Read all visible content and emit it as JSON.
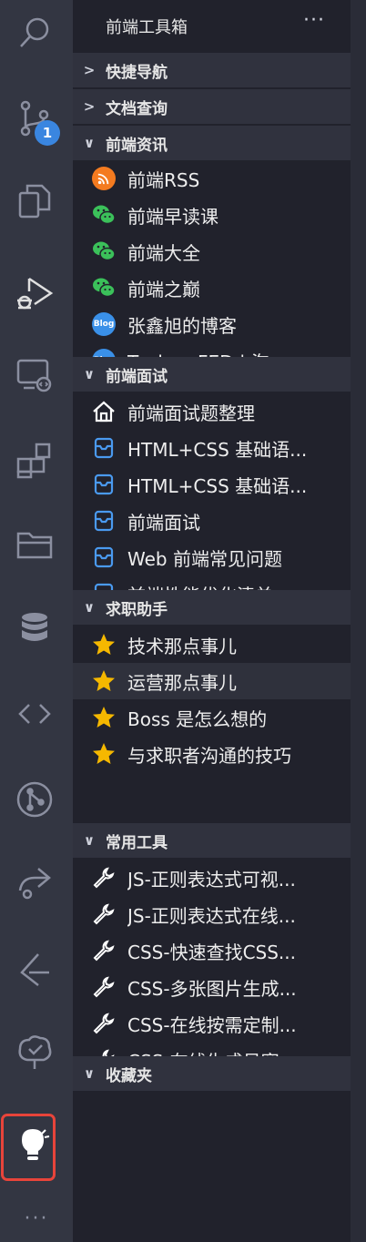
{
  "panel": {
    "title": "前端工具箱",
    "more": "···"
  },
  "activity": {
    "badge": "1",
    "more": "···"
  },
  "sections": {
    "nav": {
      "label": "快捷导航",
      "chev": ">"
    },
    "docs": {
      "label": "文档查询",
      "chev": ">"
    },
    "news": {
      "label": "前端资讯",
      "chev": "∨",
      "items": [
        "前端RSS",
        "前端早读课",
        "前端大全",
        "前端之巅",
        "张鑫旭的博客",
        "Taobao FED | 淘"
      ]
    },
    "interview": {
      "label": "前端面试",
      "chev": "∨",
      "items": [
        "前端面试题整理",
        "HTML+CSS 基础语...",
        "HTML+CSS 基础语...",
        "前端面试",
        "Web 前端常见问题",
        "前端性能优化清单"
      ]
    },
    "job": {
      "label": "求职助手",
      "chev": "∨",
      "items": [
        "技术那点事儿",
        "运营那点事儿",
        "Boss 是怎么想的",
        "与求职者沟通的技巧"
      ]
    },
    "tools": {
      "label": "常用工具",
      "chev": "∨",
      "items": [
        "JS-正则表达式可视...",
        "JS-正则表达式在线...",
        "CSS-快速查找CSS...",
        "CSS-多张图片生成...",
        "CSS-在线按需定制...",
        "CSS-在线生成贝塞"
      ]
    },
    "favorites": {
      "label": "收藏夹",
      "chev": "∨"
    }
  },
  "icons": {
    "rss": "rss-icon",
    "wechat": "wechat-icon",
    "blog": "blog-icon",
    "home": "home-icon",
    "doc": "document-icon",
    "star": "star-icon",
    "wrench": "wrench-icon"
  },
  "colors": {
    "activity_bg": "#333642",
    "panel_bg": "#21222c",
    "section_bg": "#30323e",
    "accent_badge": "#3a86e0",
    "highlight": "#e8443a",
    "rss": "#f47b20",
    "wechat": "#3bc15a",
    "star": "#f5b800",
    "doc_blue": "#4a9af0"
  }
}
